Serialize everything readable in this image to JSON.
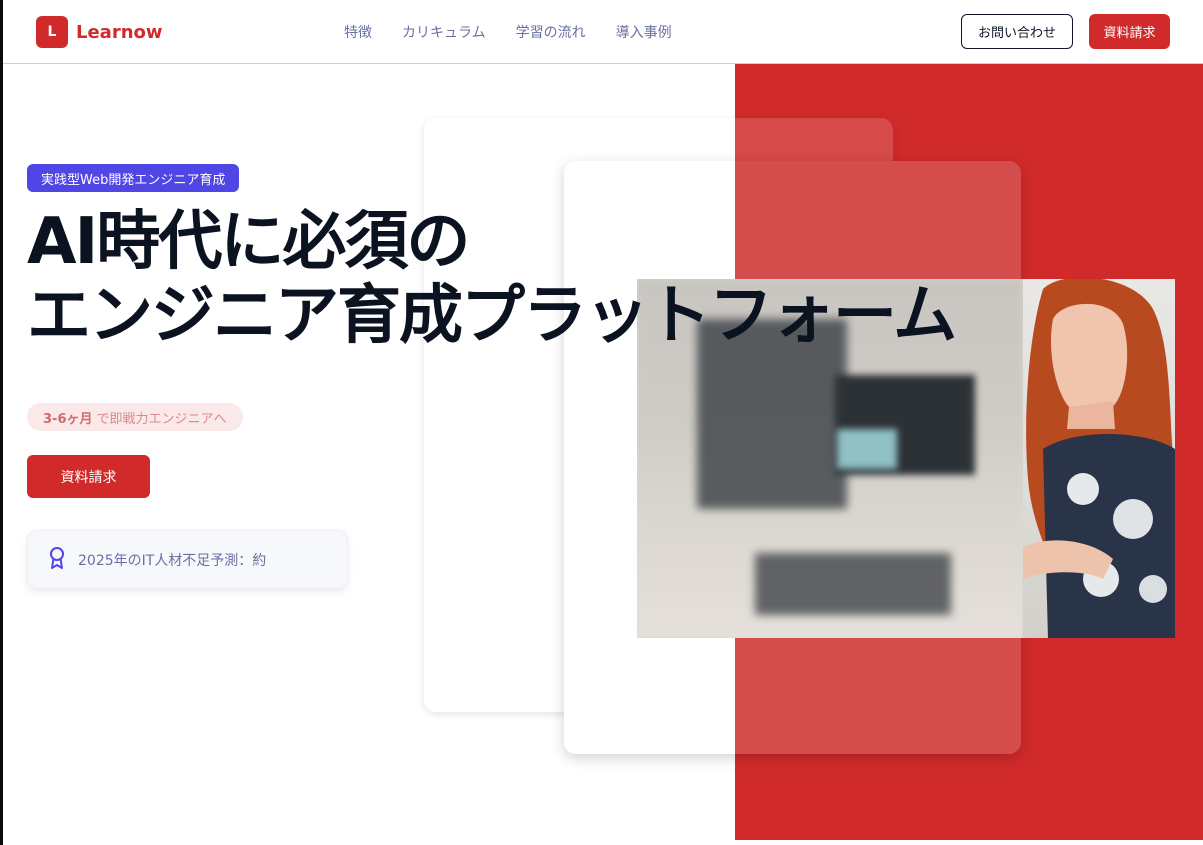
{
  "header": {
    "logo_mark": "L",
    "logo_text": "Learnow",
    "nav": [
      "特徴",
      "カリキュラム",
      "学習の流れ",
      "導入事例"
    ],
    "contact_label": "お問い合わせ",
    "request_label": "資料請求"
  },
  "hero": {
    "badge": "実践型Web開発エンジニア育成",
    "headline_line1": "AI時代に必須の",
    "headline_line2": "エンジニア育成プラットフォーム",
    "pill_strong": "3-6ヶ月",
    "pill_rest": "で即戦力エンジニアへ",
    "cta_label": "資料請求",
    "stat_text": "2025年のIT人材不足予測：約"
  },
  "colors": {
    "brand_red": "#d12a2a",
    "accent_indigo": "#4f46e5",
    "nav_text": "#6b6fa3"
  },
  "icons": {
    "award": "award-ribbon-icon"
  }
}
